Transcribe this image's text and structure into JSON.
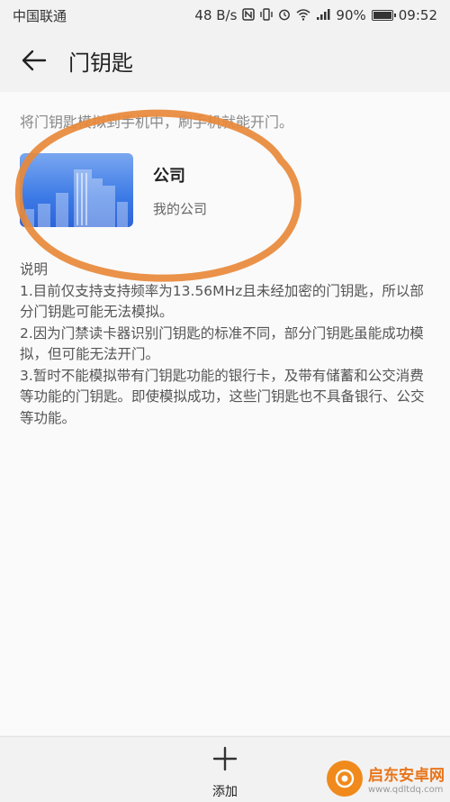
{
  "status_bar": {
    "carrier": "中国联通",
    "speed": "48 B/s",
    "battery_pct": "90%",
    "time": "09:52",
    "icons": [
      "nfc-icon",
      "vibrate-icon",
      "alarm-icon",
      "wifi-icon",
      "signal-4g-icon",
      "battery-icon"
    ]
  },
  "header": {
    "title": "门钥匙",
    "back_icon": "back-arrow-icon"
  },
  "intro": "将门钥匙模拟到手机中，刷手机就能开门。",
  "key_card": {
    "name": "公司",
    "subtitle": "我的公司"
  },
  "notes": {
    "heading": "说明",
    "items": [
      "1.目前仅支持支持频率为13.56MHz且未经加密的门钥匙，所以部分门钥匙可能无法模拟。",
      "2.因为门禁读卡器识别门钥匙的标准不同，部分门钥匙虽能成功模拟，但可能无法开门。",
      "3.暂时不能模拟带有门钥匙功能的银行卡，及带有储蓄和公交消费等功能的门钥匙。即使模拟成功，这些门钥匙也不具备银行、公交等功能。"
    ]
  },
  "bottom_bar": {
    "add_label": "添加"
  },
  "watermark": {
    "title": "启东安卓网",
    "url": "www.qdltdq.com"
  },
  "colors": {
    "accent_orange": "#e8893a",
    "card_blue": "#3c7ae6"
  }
}
